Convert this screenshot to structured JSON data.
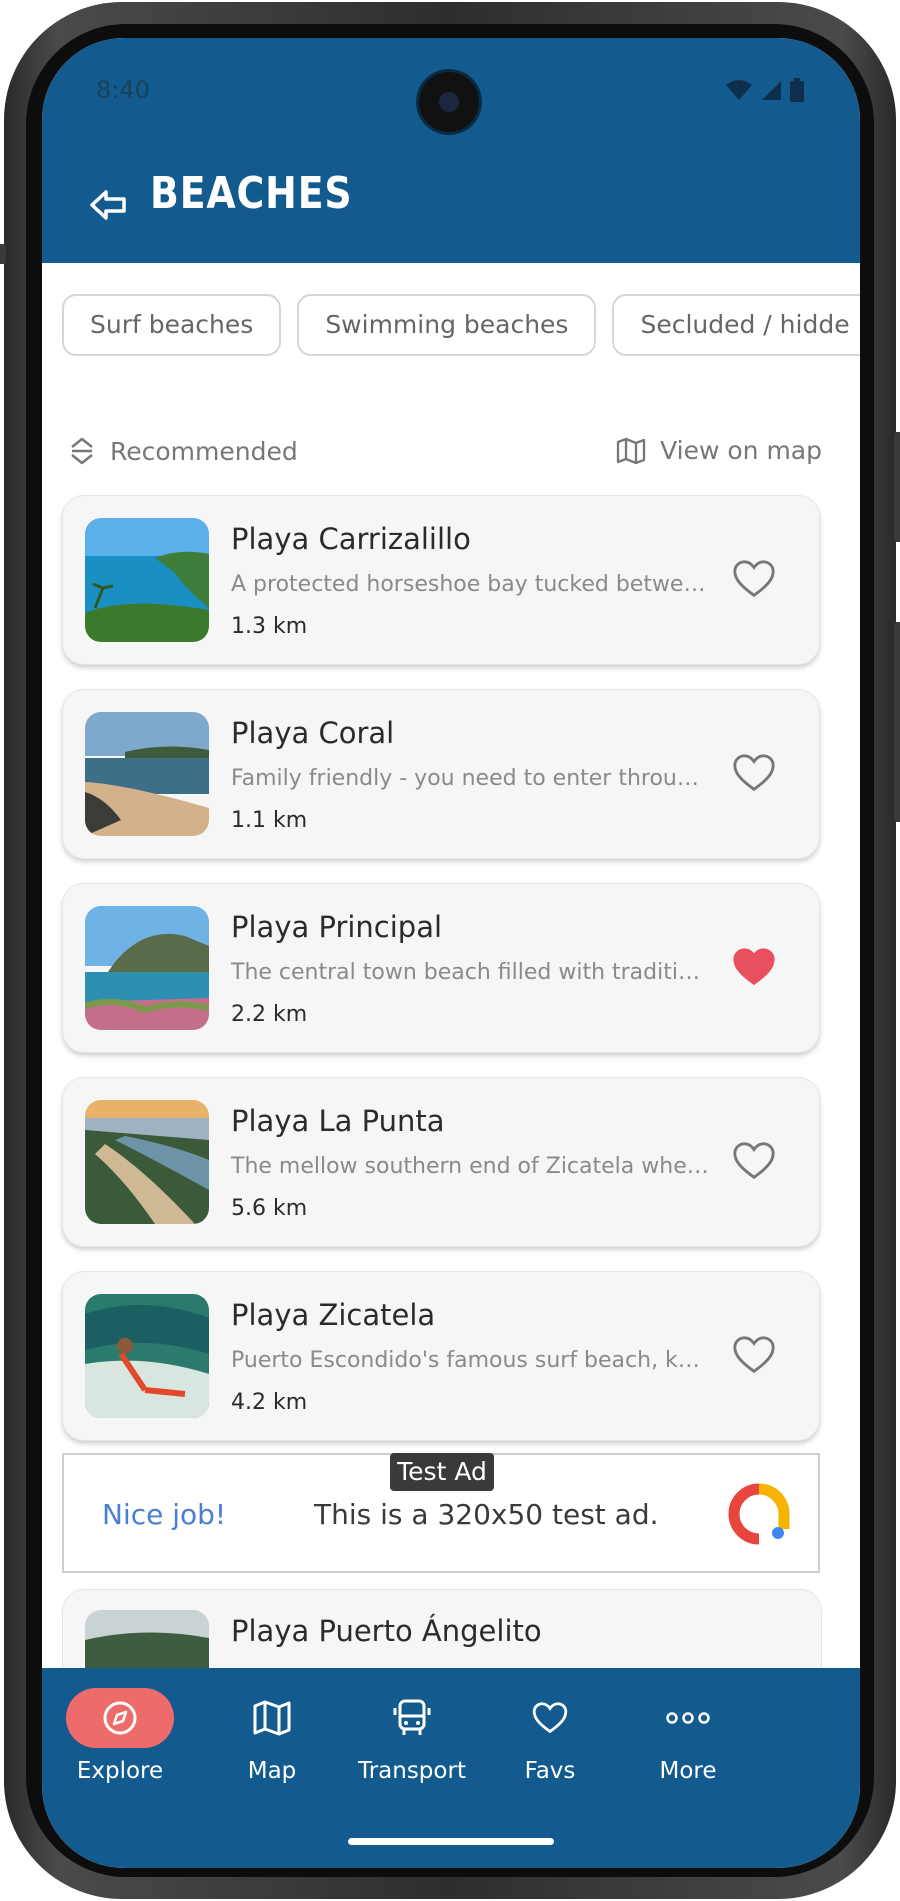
{
  "status": {
    "time": "8:40"
  },
  "header": {
    "title": "BEACHES"
  },
  "chips": [
    "Surf beaches",
    "Swimming beaches",
    "Secluded / hidde"
  ],
  "sort": {
    "label": "Recommended"
  },
  "map_link": {
    "label": "View on map"
  },
  "beaches": [
    {
      "name": "Playa Carrizalillo",
      "desc": "A protected horseshoe bay tucked betwee...",
      "dist": "1.3 km",
      "favorite": false
    },
    {
      "name": "Playa Coral",
      "desc": "Family friendly - you need to enter through...",
      "dist": "1.1 km",
      "favorite": false
    },
    {
      "name": "Playa Principal",
      "desc": "The central town beach filled with tradition...",
      "dist": "2.2 km",
      "favorite": true
    },
    {
      "name": "Playa La Punta",
      "desc": "The mellow southern end of Zicatela wher...",
      "dist": "5.6 km",
      "favorite": false
    },
    {
      "name": "Playa Zicatela",
      "desc": "Puerto Escondido's famous surf beach, kno...",
      "dist": "4.2 km",
      "favorite": false
    }
  ],
  "ad": {
    "badge": "Test Ad",
    "nice": "Nice job!",
    "text": "This is a 320x50 test ad."
  },
  "partial_beach": {
    "name": "Playa Puerto Ángelito"
  },
  "nav": [
    {
      "label": "Explore",
      "icon": "compass-icon",
      "active": true
    },
    {
      "label": "Map",
      "icon": "map-icon",
      "active": false
    },
    {
      "label": "Transport",
      "icon": "bus-icon",
      "active": false
    },
    {
      "label": "Favs",
      "icon": "heart-icon",
      "active": false
    },
    {
      "label": "More",
      "icon": "more-icon",
      "active": false
    }
  ],
  "colors": {
    "primary": "#135b8e",
    "accent": "#ee6b6b",
    "favorite": "#e9505e"
  }
}
